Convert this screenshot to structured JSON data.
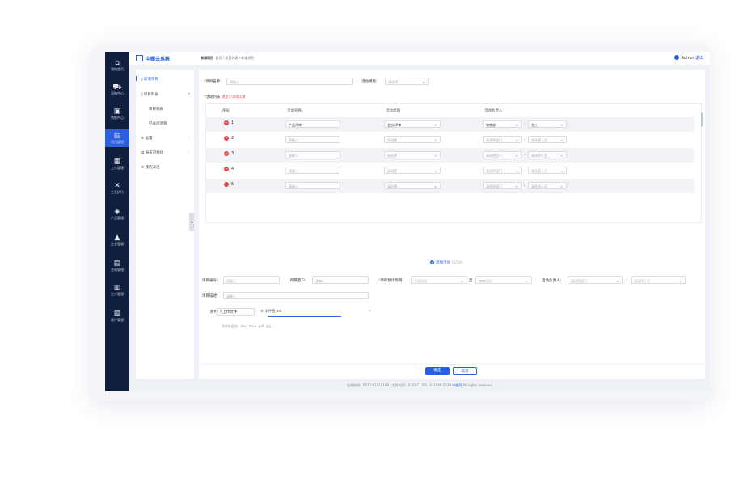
{
  "sidebar": {
    "items": [
      {
        "icon": "home-icon",
        "glyph": "⌂",
        "label": "我的首页"
      },
      {
        "icon": "cart-icon",
        "glyph": "⛟",
        "label": "采购中心"
      },
      {
        "icon": "bag-icon",
        "glyph": "▣",
        "label": "销售中心"
      },
      {
        "icon": "project-icon",
        "glyph": "▤",
        "label": "项目管理"
      },
      {
        "icon": "calendar-icon",
        "glyph": "▦",
        "label": "工作管理"
      },
      {
        "icon": "tools-icon",
        "glyph": "✕",
        "label": "工艺执行"
      },
      {
        "icon": "layers-icon",
        "glyph": "◈",
        "label": "产品管理"
      },
      {
        "icon": "building-icon",
        "glyph": "▲",
        "label": "企业管理"
      },
      {
        "icon": "doc-icon",
        "glyph": "▤",
        "label": "合同管理"
      },
      {
        "icon": "factory-icon",
        "glyph": "▥",
        "label": "生产管理"
      },
      {
        "icon": "customer-icon",
        "glyph": "▧",
        "label": "客户管理"
      }
    ]
  },
  "topbar": {
    "logo": "中耀云系统",
    "crumb_current": "新增项目",
    "crumb_path": "首页 / 项目列表 / 新增项目",
    "user": "Admin",
    "logout": "退出"
  },
  "menu": {
    "items": [
      {
        "label": "新增项目",
        "icon": "file-icon"
      },
      {
        "label": "项目列表",
        "icon": "list-icon",
        "arrow": "∨"
      },
      {
        "label": "项目列表",
        "icon": ""
      },
      {
        "label": "已关闭项目",
        "icon": ""
      },
      {
        "label": "设置",
        "icon": "gear-icon",
        "arrow": "›"
      },
      {
        "label": "报表可视化",
        "icon": "chart-icon",
        "arrow": "›"
      },
      {
        "label": "我的派活",
        "icon": "task-icon"
      }
    ],
    "collapse": "◂"
  },
  "form": {
    "name_label": "项目名称:",
    "name_placeholder": "请输入",
    "template_label": "活动模版:",
    "template_placeholder": "请选择",
    "activity_label": "活动列表",
    "activity_hint": "请至少添加1项",
    "columns": [
      "序号",
      "活动名称",
      "活动类别",
      "活动负责人"
    ],
    "rows": [
      {
        "no": "1",
        "name": "产品评审",
        "category": "会议/评审",
        "dept": "销售部",
        "person": "张三"
      },
      {
        "no": "2",
        "name": "请输入",
        "category": "请选择",
        "dept": "请选择部门",
        "person": "请选择人员"
      },
      {
        "no": "3",
        "name": "请输入",
        "category": "请选择",
        "dept": "请选择部门",
        "person": "请选择人员"
      },
      {
        "no": "4",
        "name": "请输入",
        "category": "请选择",
        "dept": "请选择部门",
        "person": "请选择人员"
      },
      {
        "no": "5",
        "name": "请输入",
        "category": "请选择",
        "dept": "请选择部门",
        "person": "请选择人员"
      }
    ],
    "add_activity": "添加活动",
    "add_count": "(5/10)",
    "code_label": "项目编号:",
    "code_placeholder": "请输入",
    "client_label": "所属客户:",
    "client_placeholder": "请输入",
    "period_label": "项目预计周期:",
    "start_placeholder": "开始时间",
    "to": "至",
    "end_placeholder": "结束时间",
    "owner_label": "活动负责人:",
    "owner_dept_placeholder": "请选择部门",
    "owner_person_placeholder": "请选择人员",
    "desc_label": "项目描述:",
    "desc_placeholder": "请输入",
    "attach_label": "附件:",
    "upload_label": "上传文件",
    "file_name": "文件名.xls",
    "ext_hint": "文件扩展名: .doc .docx .pdf .jpg...",
    "confirm": "确定",
    "cancel": "取消"
  },
  "footer": {
    "text": "咨询热线：0577-61118188（工作时间：8:30-17:30）© 1999-2018",
    "link": "中耀网",
    "rights": "All rights reserved"
  }
}
